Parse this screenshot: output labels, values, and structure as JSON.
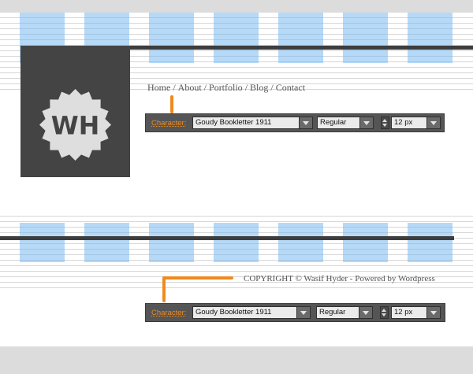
{
  "logo": {
    "monogram": "WH",
    "badge_color": "#dedede",
    "box_color": "#444444"
  },
  "nav": {
    "items": [
      "Home",
      "About",
      "Portfolio",
      "Blog",
      "Contact"
    ],
    "separator": "/"
  },
  "footer": {
    "text": "COPYRIGHT © Wasif Hyder - Powered by Wordpress"
  },
  "character_panels": [
    {
      "label": "Character:",
      "font": "Goudy Bookletter 1911",
      "style": "Regular",
      "size": "12 px"
    },
    {
      "label": "Character:",
      "font": "Goudy Bookletter 1911",
      "style": "Regular",
      "size": "12 px"
    }
  ],
  "colors": {
    "grid_column": "#a9d0f2",
    "bar": "#3d3d3d",
    "accent": "#ef8a1e",
    "panel_bg": "#555555"
  }
}
